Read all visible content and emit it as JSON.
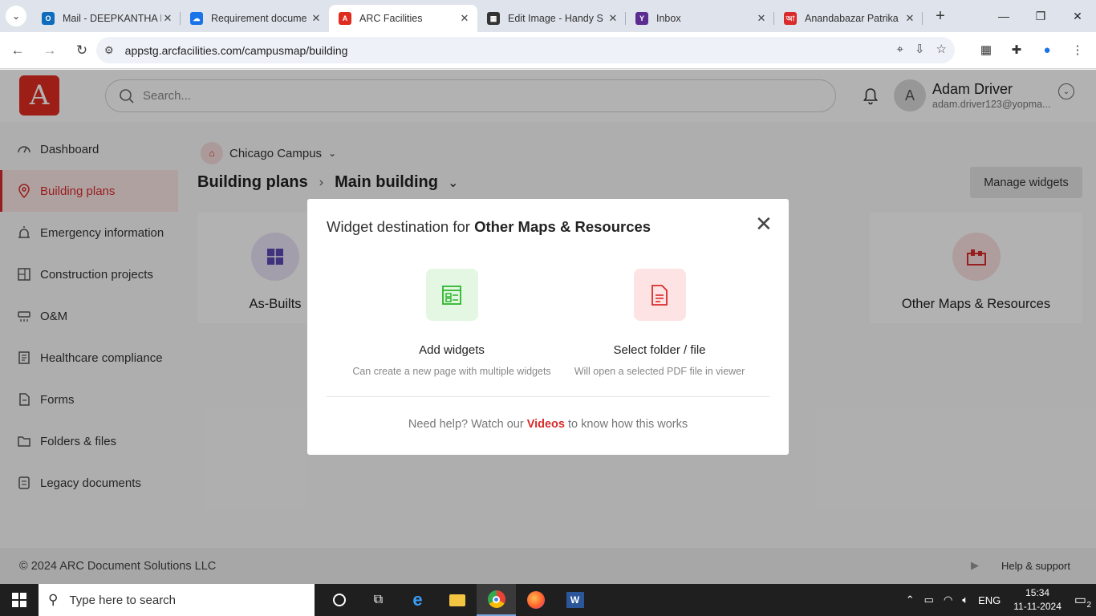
{
  "browser": {
    "tabs": [
      {
        "title": "Mail - DEEPKANTHA D",
        "favicon_color": "#0f6cbd",
        "favicon_letter": "O"
      },
      {
        "title": "Requirement docume",
        "favicon_color": "#1a73e8",
        "favicon_letter": "☁"
      },
      {
        "title": "ARC Facilities",
        "favicon_color": "#e02b20",
        "favicon_letter": "A"
      },
      {
        "title": "Edit Image - Handy S",
        "favicon_color": "#333333",
        "favicon_letter": "▦"
      },
      {
        "title": "Inbox",
        "favicon_color": "#5c2d91",
        "favicon_letter": "Y"
      },
      {
        "title": "Anandabazar Patrika",
        "favicon_color": "#d92b2b",
        "favicon_letter": "আ"
      }
    ],
    "url": "appstg.arcfacilities.com/campusmap/building"
  },
  "app": {
    "logo_letter": "A",
    "search_placeholder": "Search...",
    "user": {
      "initial": "A",
      "name": "Adam Driver",
      "email": "adam.driver123@yopma..."
    },
    "sidebar": [
      {
        "label": "Dashboard",
        "icon": "gauge-icon"
      },
      {
        "label": "Building plans",
        "icon": "location-pin-icon",
        "active": true
      },
      {
        "label": "Emergency information",
        "icon": "alarm-icon"
      },
      {
        "label": "Construction projects",
        "icon": "blueprint-icon"
      },
      {
        "label": "O&M",
        "icon": "hvac-icon"
      },
      {
        "label": "Healthcare compliance",
        "icon": "document-icon"
      },
      {
        "label": "Forms",
        "icon": "form-icon"
      },
      {
        "label": "Folders & files",
        "icon": "folder-icon"
      },
      {
        "label": "Legacy documents",
        "icon": "legacy-doc-icon"
      }
    ],
    "campus": "Chicago Campus",
    "breadcrumb": {
      "root": "Building plans",
      "current": "Main building"
    },
    "manage_widgets": "Manage widgets",
    "cards": [
      {
        "label": "As-Builts",
        "color": "#e8e3f5"
      },
      {
        "label": "Other Maps & Resources",
        "color": "#fbe0e0"
      }
    ],
    "footer": {
      "copyright": "© 2024 ARC Document Solutions LLC",
      "help": "Help & support"
    }
  },
  "modal": {
    "title_prefix": "Widget destination for ",
    "title_bold": "Other Maps & Resources",
    "options": [
      {
        "title": "Add widgets",
        "desc": "Can create a new page with multiple widgets",
        "bg": "#e3f7e3",
        "fg": "#2bb52b"
      },
      {
        "title": "Select folder / file",
        "desc": "Will open a selected PDF file in viewer",
        "bg": "#fde3e3",
        "fg": "#d92b2b"
      }
    ],
    "help_prefix": "Need help? Watch our ",
    "help_link": "Videos",
    "help_suffix": " to know how this works"
  },
  "taskbar": {
    "search_placeholder": "Type here to search",
    "lang": "ENG",
    "time": "15:34",
    "date": "11-11-2024",
    "notifications": "2"
  }
}
